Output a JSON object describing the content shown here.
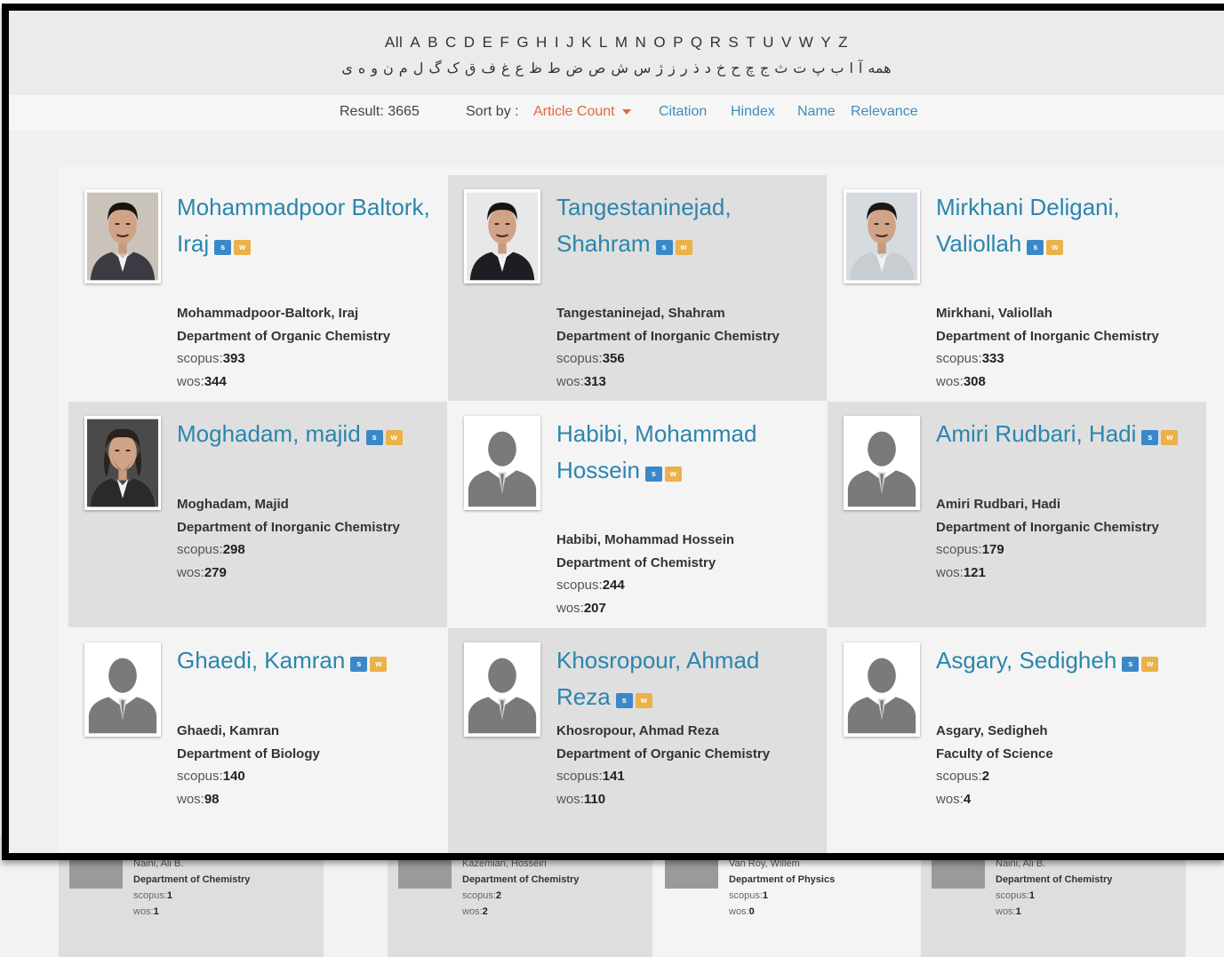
{
  "alphabet": {
    "latin": [
      "All",
      "A",
      "B",
      "C",
      "D",
      "E",
      "F",
      "G",
      "H",
      "I",
      "J",
      "K",
      "L",
      "M",
      "N",
      "O",
      "P",
      "Q",
      "R",
      "S",
      "T",
      "U",
      "V",
      "W",
      "Y",
      "Z"
    ],
    "persian": [
      "همه",
      "آ",
      "ا",
      "ب",
      "پ",
      "ت",
      "ث",
      "ج",
      "چ",
      "ح",
      "خ",
      "د",
      "ذ",
      "ر",
      "ز",
      "ژ",
      "س",
      "ش",
      "ص",
      "ض",
      "ط",
      "ظ",
      "ع",
      "غ",
      "ف",
      "ق",
      "ک",
      "گ",
      "ل",
      "م",
      "ن",
      "و",
      "ه",
      "ی"
    ]
  },
  "sort_bar": {
    "result": "Result: 3665",
    "sort_label": "Sort by :",
    "active": "Article Count",
    "options": [
      "Citation",
      "Hindex",
      "Name",
      "Relevance"
    ]
  },
  "labels": {
    "scopus": "scopus:",
    "wos": "wos:",
    "badge_s": "s",
    "badge_w": "w"
  },
  "researchers": [
    {
      "title": "Mohammadpoor Baltork, Iraj",
      "alias": "Mohammadpoor-Baltork, Iraj",
      "dept": "Department of Organic Chemistry",
      "scopus": "393",
      "wos": "344",
      "photo": "portrait"
    },
    {
      "title": "Tangestaninejad, Shahram",
      "alias": "Tangestaninejad, Shahram",
      "dept": "Department of Inorganic Chemistry",
      "scopus": "356",
      "wos": "313",
      "photo": "portrait"
    },
    {
      "title": "Mirkhani Deligani, Valiollah",
      "alias": "Mirkhani, Valiollah",
      "dept": "Department of Inorganic Chemistry",
      "scopus": "333",
      "wos": "308",
      "photo": "portrait"
    },
    {
      "title": "Moghadam, majid",
      "alias": "Moghadam, Majid",
      "dept": "Department of Inorganic Chemistry",
      "scopus": "298",
      "wos": "279",
      "photo": "portrait"
    },
    {
      "title": "Habibi, Mohammad Hossein",
      "alias": "Habibi, Mohammad Hossein",
      "dept": "Department of Chemistry",
      "scopus": "244",
      "wos": "207",
      "photo": "placeholder"
    },
    {
      "title": "Amiri Rudbari, Hadi",
      "alias": "Amiri Rudbari, Hadi",
      "dept": "Department of Inorganic Chemistry",
      "scopus": "179",
      "wos": "121",
      "photo": "placeholder"
    },
    {
      "title": "Ghaedi, Kamran",
      "alias": "Ghaedi, Kamran",
      "dept": "Department of Biology",
      "scopus": "140",
      "wos": "98",
      "photo": "placeholder"
    },
    {
      "title": "Khosropour, Ahmad Reza",
      "alias": "Khosropour, Ahmad Reza",
      "dept": "Department of Organic Chemistry",
      "scopus": "141",
      "wos": "110",
      "photo": "placeholder"
    },
    {
      "title": "Asgary, Sedigheh",
      "alias": "Asgary, Sedigheh",
      "dept": "Faculty of Science",
      "scopus": "2",
      "wos": "4",
      "photo": "placeholder"
    }
  ],
  "background_cards": [
    {
      "alias": "Naini, Ali B.",
      "dept": "Department of Chemistry",
      "scopus": "1",
      "wos": "1"
    },
    {
      "alias": "Kazemian, Hossein",
      "dept": "Department of Chemistry",
      "scopus": "2",
      "wos": "2"
    },
    {
      "alias": "Van Roy, Willem",
      "dept": "Department of Physics",
      "scopus": "1",
      "wos": "0"
    },
    {
      "alias": "Naini, Ali B.",
      "dept": "Department of Chemistry",
      "scopus": "1",
      "wos": "1"
    }
  ],
  "colors": {
    "link": "#2a86ad",
    "active_sort": "#e1673d",
    "badge_s": "#3a88c8",
    "badge_w": "#ebb14a"
  }
}
